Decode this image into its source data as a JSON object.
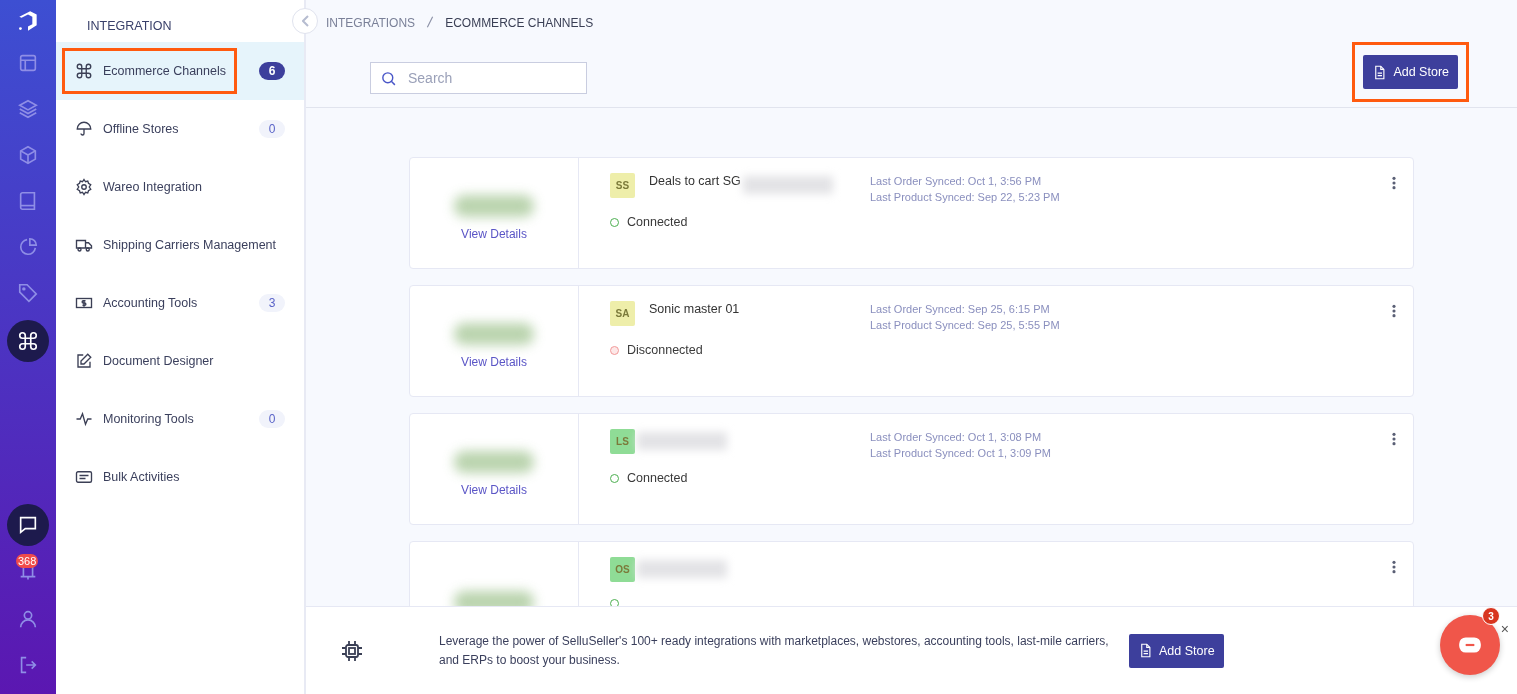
{
  "rail": {
    "top": [
      {
        "kind": "layout",
        "selected": false
      },
      {
        "kind": "layers",
        "selected": false
      },
      {
        "kind": "box",
        "selected": false
      },
      {
        "kind": "book",
        "selected": false
      },
      {
        "kind": "pie",
        "selected": false
      },
      {
        "kind": "tag",
        "selected": false
      },
      {
        "kind": "command",
        "selected": true
      }
    ],
    "bottom": [
      {
        "kind": "chat",
        "selected": true
      },
      {
        "kind": "bell",
        "selected": false,
        "badge": "368"
      },
      {
        "kind": "user",
        "selected": false
      },
      {
        "kind": "logout",
        "selected": false
      }
    ]
  },
  "sidebar": {
    "title": "INTEGRATION",
    "items": [
      {
        "kind": "command",
        "label": "Ecommerce Channels",
        "count": "6",
        "selected": true,
        "highlighted": true
      },
      {
        "kind": "umbrella",
        "label": "Offline Stores",
        "count": "0",
        "selected": false,
        "highlighted": false
      },
      {
        "kind": "gear",
        "label": "Wareo Integration",
        "selected": false,
        "highlighted": false
      },
      {
        "kind": "truck",
        "label": "Shipping Carriers Management",
        "selected": false,
        "highlighted": false
      },
      {
        "kind": "cash",
        "label": "Accounting Tools",
        "count": "3",
        "selected": false,
        "highlighted": false
      },
      {
        "kind": "edit",
        "label": "Document Designer",
        "selected": false,
        "highlighted": false
      },
      {
        "kind": "pulse",
        "label": "Monitoring Tools",
        "count": "0",
        "selected": false,
        "highlighted": false
      },
      {
        "kind": "list",
        "label": "Bulk Activities",
        "selected": false,
        "highlighted": false
      }
    ]
  },
  "breadcrumb": [
    "INTEGRATIONS",
    "ECOMMERCE CHANNELS"
  ],
  "search": {
    "placeholder": "Search"
  },
  "add_store": {
    "label": "Add Store",
    "highlighted": true
  },
  "stores": [
    {
      "initials": "SS",
      "color": "#eeeeaa",
      "name": "Deals to cart SG",
      "redacted": true,
      "link": "View Details",
      "status": "Connected",
      "connected": true,
      "sync": [
        "Last Order Synced: Oct 1, 3:56 PM",
        "Last Product Synced: Sep 22, 5:23 PM"
      ]
    },
    {
      "initials": "SA",
      "color": "#eeeeaa",
      "name": "Sonic master 01",
      "redacted": false,
      "link": "View Details",
      "status": "Disconnected",
      "connected": false,
      "sync": [
        "Last Order Synced: Sep 25, 6:15 PM",
        "Last Product Synced: Sep 25, 5:55 PM"
      ]
    },
    {
      "initials": "LS",
      "color": "#8fdc96",
      "redacted": true,
      "link": "View Details",
      "status": "Connected",
      "connected": true,
      "sync": [
        "Last Order Synced: Oct 1, 3:08 PM",
        "Last Product Synced: Oct 1, 3:09 PM"
      ]
    },
    {
      "initials": "OS",
      "color": "#8fdc96",
      "redacted": true,
      "connected": true
    }
  ],
  "banner": {
    "text": "Leverage the power of SelluSeller's 100+ ready integrations with marketplaces, webstores, accounting tools, last-mile carriers, and ERPs to boost your business.",
    "button": "Add Store"
  },
  "chat": {
    "badge": "3",
    "close": "×"
  }
}
